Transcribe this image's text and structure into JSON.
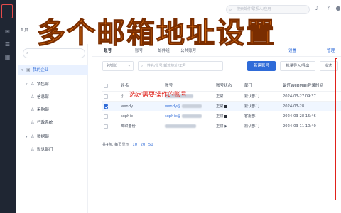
{
  "topbar": {
    "search_placeholder": "搜索邮件/联系人/应用",
    "icons": [
      "search-icon",
      "bell-icon",
      "help-icon",
      "user-icon"
    ]
  },
  "breadcrumb": "首页",
  "headline": "多个邮箱地址设置",
  "tree": {
    "search_placeholder": "",
    "items": [
      {
        "label": "我的企业",
        "icon": "building-icon",
        "level": 0,
        "active": true
      },
      {
        "label": "销售部",
        "icon": "group-icon",
        "level": 1
      },
      {
        "label": "信息部",
        "icon": "group-icon",
        "level": 2
      },
      {
        "label": "采购部",
        "icon": "group-icon",
        "level": 2
      },
      {
        "label": "行政系统",
        "icon": "group-icon",
        "level": 2
      },
      {
        "label": "数据部",
        "icon": "group-icon",
        "level": 1
      },
      {
        "label": "默认部门",
        "icon": "group-icon",
        "level": 2
      }
    ]
  },
  "tabs": [
    {
      "label": "账号",
      "active": true
    },
    {
      "label": "账号"
    },
    {
      "label": "邮件组"
    },
    {
      "label": "公共账号"
    }
  ],
  "tabs_right": {
    "add_label": "设置",
    "manage_label": "管理"
  },
  "toolbar": {
    "dept_select": "全部账",
    "search_placeholder": "姓名/账号/邮箱地址/工号",
    "new_button": "新建账号",
    "batch_button": "批量导入/导出",
    "more_button": "状态"
  },
  "table": {
    "headers": [
      "姓名",
      "账号",
      "账号状态",
      "部门",
      "最近WebMail登录时间"
    ],
    "rows": [
      {
        "name": "小",
        "account": "",
        "status": "正常",
        "dept": "默认部门",
        "last_login": "2024-03-27 09:37",
        "selected": false
      },
      {
        "name": "wendy",
        "account": "wendy@",
        "status": "正常",
        "dept": "默认部门",
        "last_login": "2024-03-28",
        "selected": true
      },
      {
        "name": "sophie",
        "account": "sophie@",
        "status": "正常",
        "dept": "客服部",
        "last_login": "2024-03-28 15:46",
        "selected": false
      },
      {
        "name": "离职备份",
        "account": "",
        "status": "正常",
        "dept": "默认部门",
        "last_login": "2024-03-11 10:40",
        "selected": false
      }
    ]
  },
  "footer": {
    "summary": "共4条, 每页显示",
    "page_sizes": [
      "10",
      "20",
      "50"
    ]
  },
  "annotation": "选定需要操作的账号",
  "colors": {
    "accent": "#2f6bd8",
    "headline": "#f27d12",
    "annotation": "#e0221b",
    "rail": "#1f2633"
  }
}
